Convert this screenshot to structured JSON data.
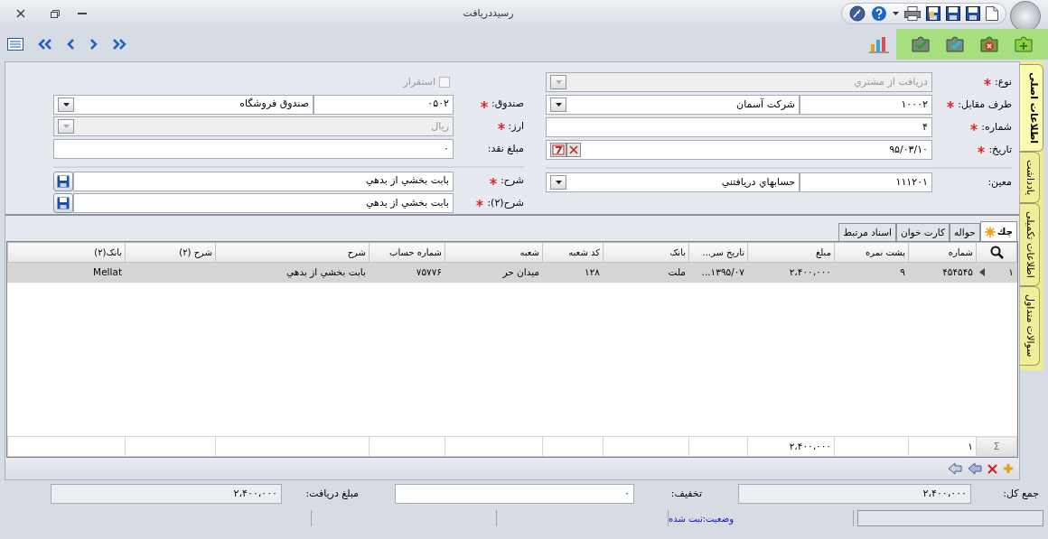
{
  "window": {
    "title": "رسيددريافت"
  },
  "form": {
    "right": [
      {
        "kind": "combo",
        "label": "نوع:",
        "required": true,
        "value": "دریافت از مشتري",
        "disabled": true
      },
      {
        "kind": "code_combo",
        "label": "طرف مقابل:",
        "required": true,
        "code": "۱۰۰۰۲",
        "value": "شرکت آسمان",
        "disabled": false
      },
      {
        "kind": "text",
        "label": "شماره:",
        "required": true,
        "value": "۴"
      },
      {
        "kind": "date",
        "label": "تاریخ:",
        "required": true,
        "value": "۹۵/۰۳/۱۰"
      },
      {
        "kind": "separator"
      },
      {
        "kind": "code_combo",
        "label": "معین:",
        "required": false,
        "code": "۱۱۱۲۰۱",
        "value": "حسابهاي دريافتني",
        "disabled": false
      }
    ],
    "left": [
      {
        "kind": "checkbox",
        "label": "استقرار",
        "checked": false,
        "disabled": true
      },
      {
        "kind": "code_combo",
        "label": "صندوق:",
        "required": true,
        "code": "۰۵۰۲",
        "value": "صندوق فروشگاه",
        "disabled": false
      },
      {
        "kind": "combo",
        "label": "ارز:",
        "required": true,
        "value": "ریال",
        "disabled": true
      },
      {
        "kind": "text",
        "label": "مبلغ نقد:",
        "required": false,
        "value": "۰"
      },
      {
        "kind": "separator"
      },
      {
        "kind": "text_save",
        "label": "شرح:",
        "required": true,
        "value": "بابت بخشي از بدهي"
      },
      {
        "kind": "text_save",
        "label": "شرح(۲):",
        "required": true,
        "value": "بابت بخشي از بدهي"
      }
    ]
  },
  "side_tabs": [
    {
      "label": "اطلاعات اصلی",
      "selected": true
    },
    {
      "label": "یادداشت",
      "selected": false
    },
    {
      "label": "اطلاعات تکمیلی",
      "selected": false
    },
    {
      "label": "سوالات متداول",
      "selected": false
    }
  ],
  "grid_tabs": [
    {
      "label": "چك",
      "selected": true
    },
    {
      "label": "حواله",
      "selected": false
    },
    {
      "label": "کارت خوان",
      "selected": false
    },
    {
      "label": "اسناد مرتبط",
      "selected": false
    }
  ],
  "table": {
    "columns": [
      "شماره",
      "پشت نمره",
      "مبلغ",
      "تاریخ سر...",
      "بانک",
      "کد شعبه",
      "شعبه",
      "شماره حساب",
      "شرح",
      "شرح (۲)",
      "بانک(۲)"
    ],
    "rows": [
      {
        "indicator": "۱",
        "selected": true,
        "cells": [
          "۴۵۴۵۴۵",
          "۹",
          "۲،۴۰۰،۰۰۰",
          "۱۳۹۵/۰۷...",
          "ملت",
          "۱۲۸",
          "میدان حر",
          "۷۵۷۷۶",
          "بابت بخشي از بدهي",
          null,
          "Mellat"
        ]
      }
    ],
    "footer": {
      "symbol": "Σ",
      "count": "۱",
      "amount": "۲،۴۰۰،۰۰۰"
    }
  },
  "totals": [
    {
      "label": "جمع کل:",
      "value": "۲،۴۰۰،۰۰۰",
      "readonly": true
    },
    {
      "label": "تخفیف:",
      "value": "۰",
      "readonly": false
    },
    {
      "label": "مبلغ دریافت:",
      "value": "۲،۴۰۰،۰۰۰",
      "readonly": true
    }
  ],
  "status_bar": {
    "text": "وضعیت:ثبت شده"
  }
}
